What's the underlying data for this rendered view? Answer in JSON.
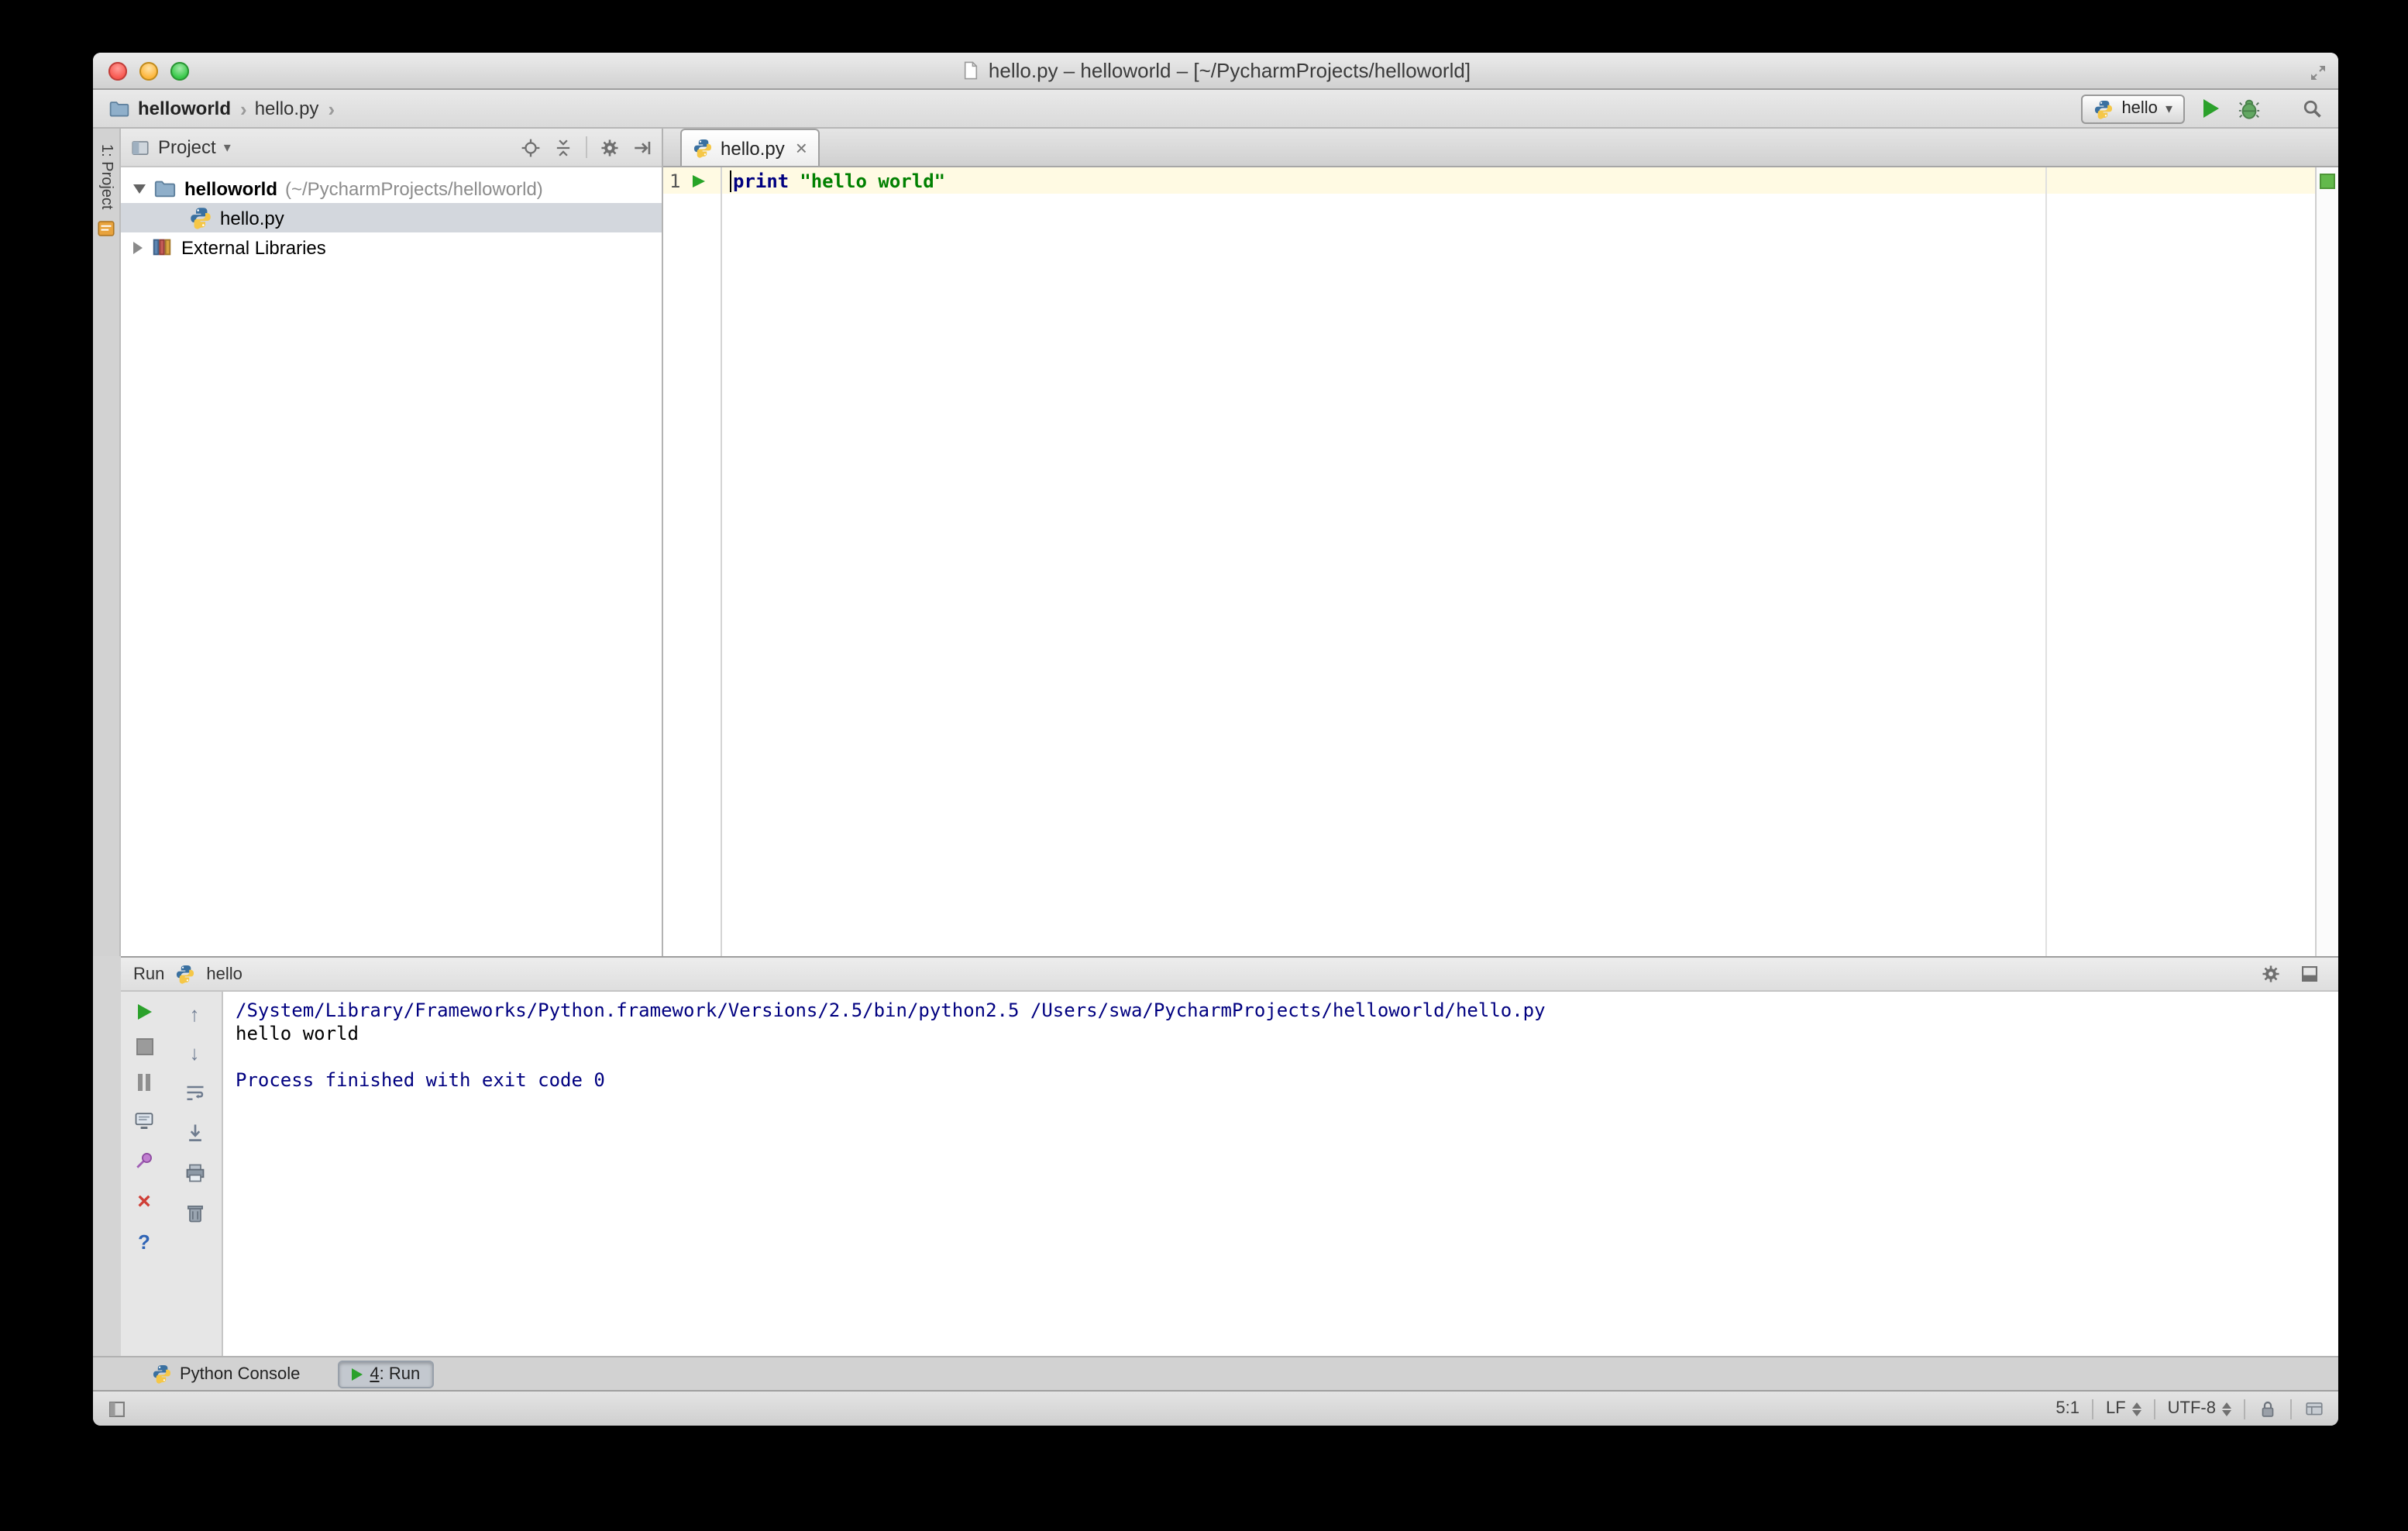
{
  "window": {
    "title": "hello.py – helloworld – [~/PycharmProjects/helloworld]"
  },
  "navbar": {
    "crumb_project": "helloworld",
    "crumb_file": "hello.py",
    "run_config_label": "hello"
  },
  "left_stripe": {
    "project_label": "1: Project"
  },
  "project_panel": {
    "header_label": "Project",
    "root_name": "helloworld",
    "root_path": "(~/PycharmProjects/helloworld)",
    "file_name": "hello.py",
    "external_libraries": "External Libraries"
  },
  "editor": {
    "tab_label": "hello.py",
    "line_number": "1",
    "code_keyword": "print",
    "code_string": "\"hello world\""
  },
  "run_panel": {
    "title": "Run",
    "tab_label": "hello",
    "console": [
      {
        "type": "system",
        "text": "/System/Library/Frameworks/Python.framework/Versions/2.5/bin/python2.5 /Users/swa/PycharmProjects/helloworld/hello.py"
      },
      {
        "type": "stdout",
        "text": "hello world"
      },
      {
        "type": "stdout",
        "text": ""
      },
      {
        "type": "system",
        "text": "Process finished with exit code 0"
      }
    ]
  },
  "bottom_bar": {
    "python_console_label": "Python Console",
    "run_mnemonic": "4",
    "run_rest": ": Run"
  },
  "status_bar": {
    "caret_position": "5:1",
    "line_separator": "LF",
    "encoding": "UTF-8"
  },
  "icons": {
    "run": "green-play-triangle",
    "stop": "gray-square",
    "debug": "green-bug",
    "search": "magnifier",
    "error_stripe_marker": "green-square",
    "file_type": "python-logo"
  },
  "colors": {
    "keyword": "#000080",
    "string": "#008000",
    "console_system": "#000080",
    "current_line_highlight": "#fffae3",
    "selection_inactive": "#d3d7dd",
    "run_green": "#2ba12b"
  }
}
